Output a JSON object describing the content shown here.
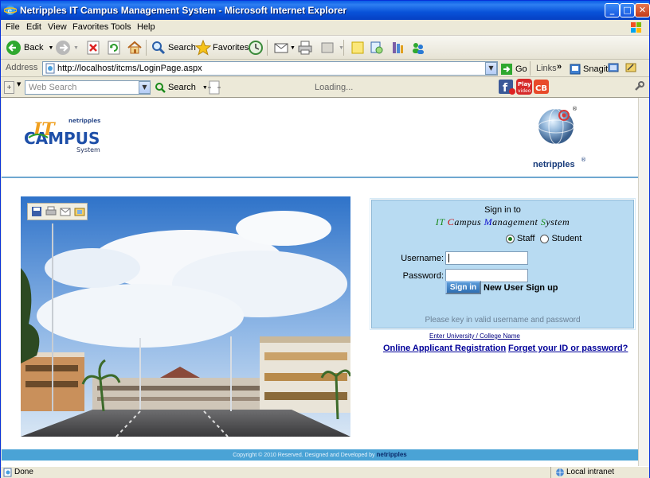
{
  "window": {
    "title": "Netripples IT Campus Management System - Microsoft Internet Explorer",
    "min": "_",
    "max": "□",
    "close": "✕"
  },
  "menu": [
    "File",
    "Edit",
    "View",
    "Favorites",
    "Tools",
    "Help"
  ],
  "toolbar": {
    "back": "Back",
    "search": "Search",
    "favorites": "Favorites"
  },
  "address": {
    "label": "Address",
    "url": "http://localhost/itcms/LoginPage.aspx",
    "go": "Go",
    "links": "Links",
    "more": "»",
    "snagit": "Snagit"
  },
  "searchbar": {
    "placeholder": "Web Search",
    "search": "Search",
    "loading": "Loading..."
  },
  "page": {
    "logo_left": {
      "brand": "netripples",
      "it": "IT",
      "campus": "CAMPUS",
      "system": "System"
    },
    "logo_right": {
      "brand": "netripples",
      "reg": "®"
    },
    "signin": {
      "line1": "Sign in to",
      "title_parts": [
        {
          "text": "IT",
          "color": "#1a8a1a"
        },
        {
          "text": " ",
          "color": "#000"
        },
        {
          "text": "C",
          "color": "#cc0000"
        },
        {
          "text": "ampus ",
          "color": "#000"
        },
        {
          "text": "M",
          "color": "#0000cc"
        },
        {
          "text": "anagement ",
          "color": "#000"
        },
        {
          "text": "S",
          "color": "#1a8a1a"
        },
        {
          "text": "ystem",
          "color": "#000"
        }
      ],
      "role_staff": "Staff",
      "role_student": "Student",
      "selected_role": "Staff",
      "username_label": "Username:",
      "password_label": "Password:",
      "username_value": "",
      "password_value": "",
      "signin_button": "Sign in",
      "new_user": "New User Sign up",
      "hint": "Please key in valid username and password"
    },
    "enter_university": "Enter University / College Name",
    "online_registration": "Online Applicant Registration",
    "forgot": "Forget your ID or password?",
    "footer_text": "Copyright © 2010 Reserved. Designed and Developed by ",
    "footer_brand": "netripples"
  },
  "status": {
    "left": "Done",
    "zone": "Local intranet"
  }
}
